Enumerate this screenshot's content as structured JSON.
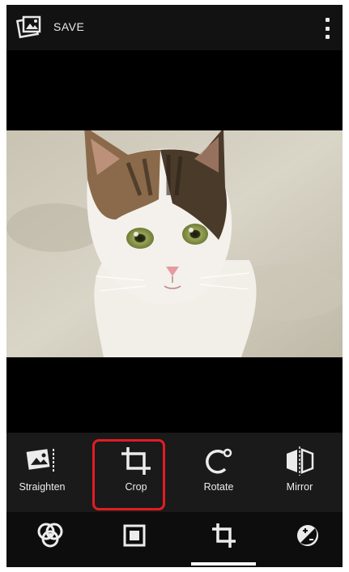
{
  "topbar": {
    "app_icon": "photo-editor-icon",
    "save_label": "SAVE",
    "overflow_icon": "more-vert-icon"
  },
  "photo": {
    "subject_icon": "cat-photo"
  },
  "tools": [
    {
      "label": "Straighten",
      "icon": "straighten-icon"
    },
    {
      "label": "Crop",
      "icon": "crop-icon",
      "selected": true
    },
    {
      "label": "Rotate",
      "icon": "rotate-icon"
    },
    {
      "label": "Mirror",
      "icon": "mirror-icon"
    }
  ],
  "categories": [
    {
      "icon": "filters-icon"
    },
    {
      "icon": "frames-icon"
    },
    {
      "icon": "geometry-icon",
      "selected": true
    },
    {
      "icon": "adjust-icon"
    }
  ],
  "colors": {
    "highlight": "#e31c22",
    "toolbar_bg": "#1a1a1a",
    "bottombar_bg": "#0d0d0d"
  }
}
